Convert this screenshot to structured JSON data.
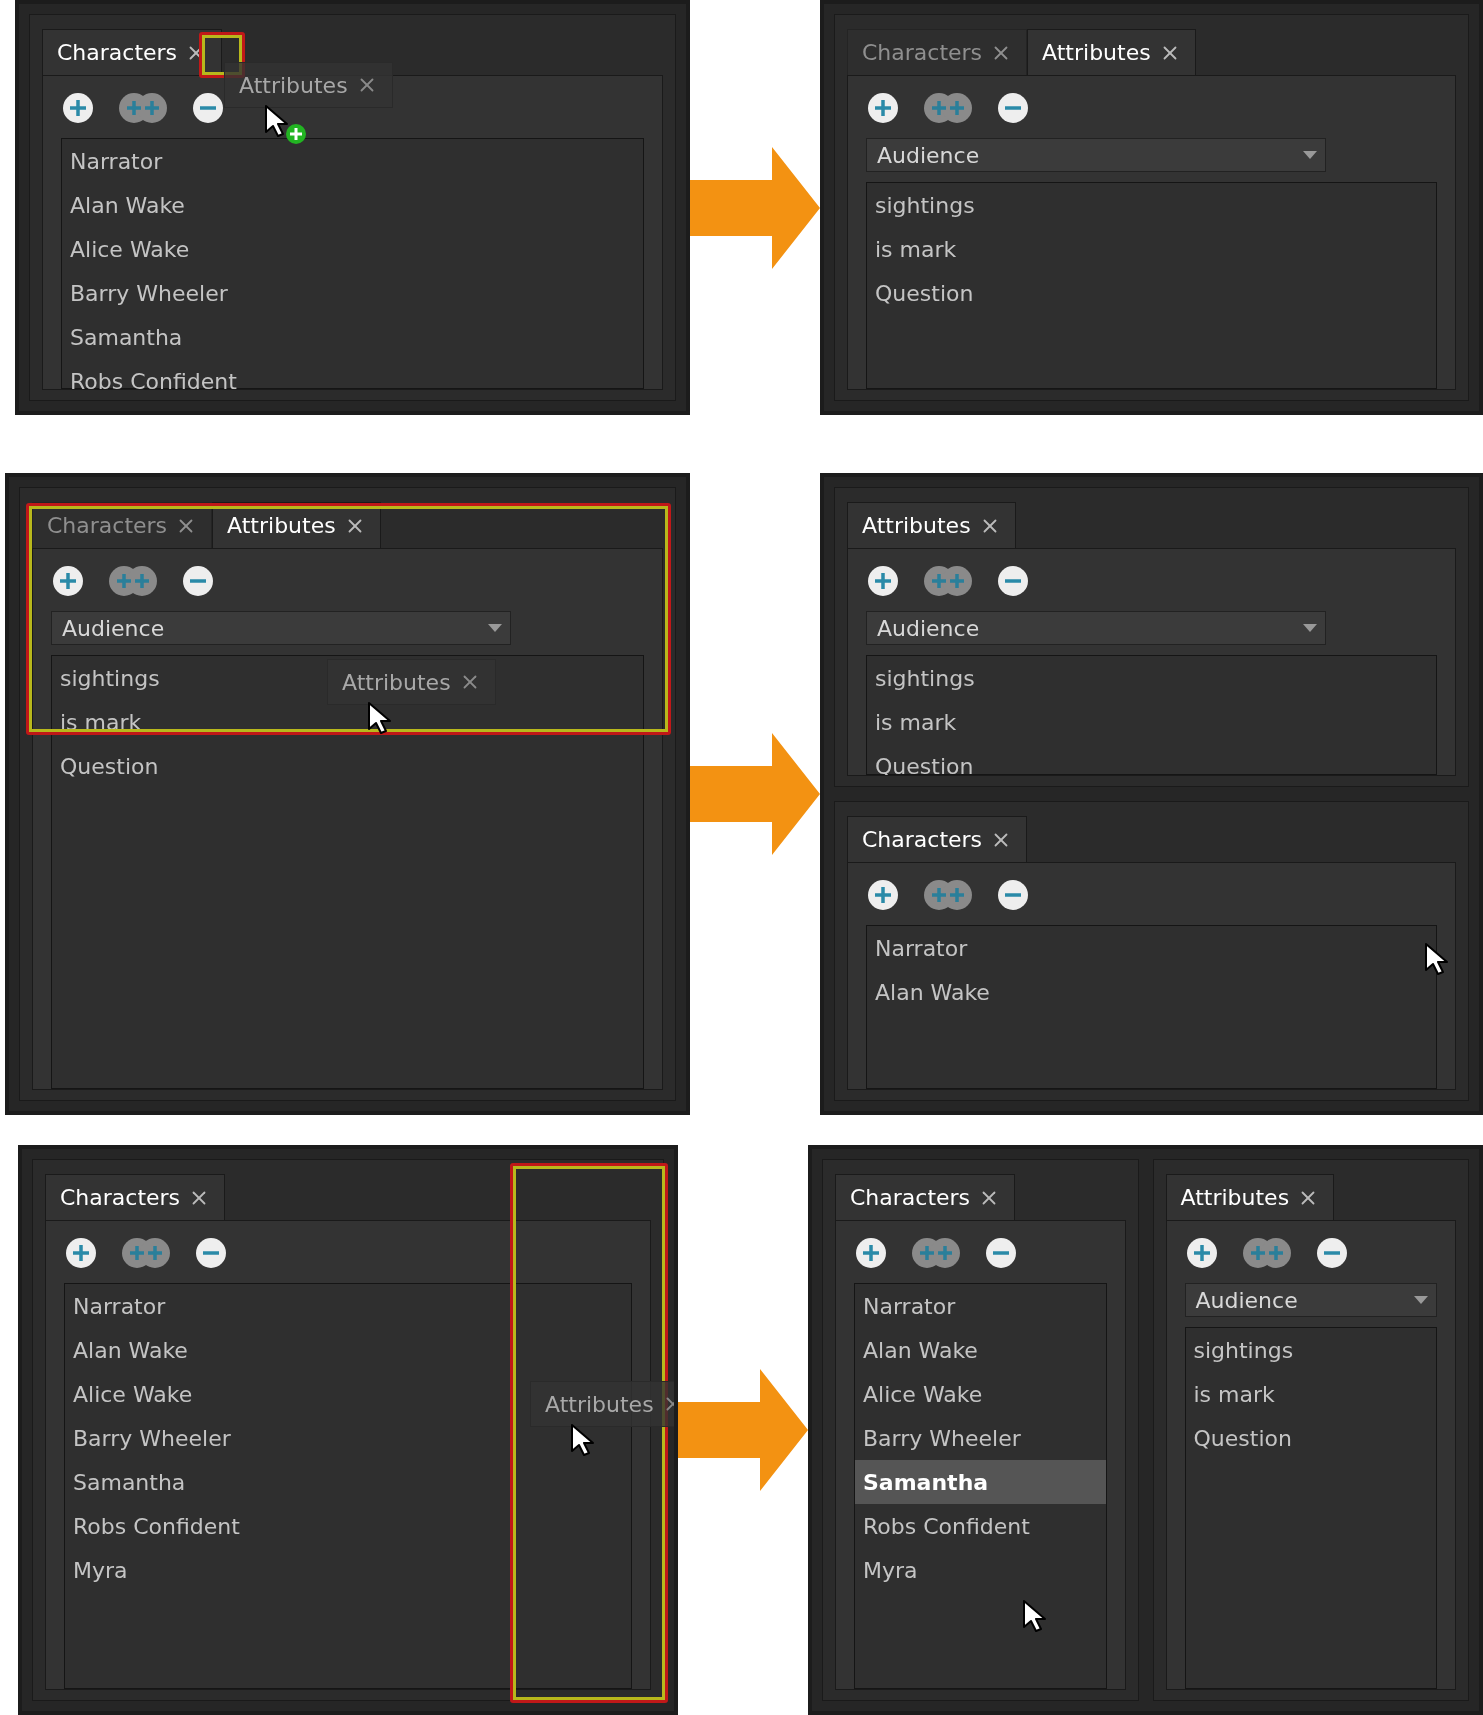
{
  "steps": [
    {
      "before": {
        "panes": [
          {
            "tabs": [
              {
                "label": "Characters",
                "selected": true
              }
            ],
            "items": [
              {
                "label": "Narrator",
                "selected": false
              },
              {
                "label": "Alan Wake",
                "selected": false
              },
              {
                "label": "Alice Wake",
                "selected": false
              },
              {
                "label": "Barry Wheeler",
                "selected": false
              },
              {
                "label": "Samantha",
                "selected": false
              },
              {
                "label": "Robs Confident",
                "selected": false
              }
            ]
          }
        ],
        "highlight": {
          "kind": "tab"
        },
        "ghost": {
          "label": "Attributes",
          "kind": "tab",
          "copy": true
        }
      },
      "after": {
        "panes": [
          {
            "tabs": [
              {
                "label": "Characters",
                "selected": false
              },
              {
                "label": "Attributes",
                "selected": true
              }
            ],
            "dropdown": "Audience",
            "items": [
              {
                "label": "sightings",
                "selected": false
              },
              {
                "label": "is mark",
                "selected": false
              },
              {
                "label": "Question",
                "selected": false
              }
            ]
          }
        ]
      }
    },
    {
      "before": {
        "panes": [
          {
            "tabs": [
              {
                "label": "Characters",
                "selected": false
              },
              {
                "label": "Attributes",
                "selected": true
              }
            ],
            "dropdown": "Audience",
            "items": [
              {
                "label": "sightings",
                "selected": false
              },
              {
                "label": "is mark",
                "selected": false
              },
              {
                "label": "Question",
                "selected": false
              }
            ]
          }
        ],
        "highlight": {
          "kind": "top"
        },
        "ghost": {
          "label": "Attributes",
          "kind": "list",
          "copy": false
        }
      },
      "after": {
        "side_by_side": false,
        "cursor": {
          "kind": "corner"
        },
        "panes": [
          {
            "tabs": [
              {
                "label": "Attributes",
                "selected": true
              }
            ],
            "dropdown": "Audience",
            "items": [
              {
                "label": "sightings",
                "selected": false
              },
              {
                "label": "is mark",
                "selected": false
              },
              {
                "label": "Question",
                "selected": false
              }
            ]
          },
          {
            "tabs": [
              {
                "label": "Characters",
                "selected": true
              }
            ],
            "items": [
              {
                "label": "Narrator",
                "selected": false
              },
              {
                "label": "Alan Wake",
                "selected": false
              }
            ]
          }
        ]
      }
    },
    {
      "before": {
        "panes": [
          {
            "tabs": [
              {
                "label": "Characters",
                "selected": true
              }
            ],
            "items": [
              {
                "label": "Narrator",
                "selected": false
              },
              {
                "label": "Alan Wake",
                "selected": false
              },
              {
                "label": "Alice Wake",
                "selected": false
              },
              {
                "label": "Barry Wheeler",
                "selected": false
              },
              {
                "label": "Samantha",
                "selected": false
              },
              {
                "label": "Robs Confident",
                "selected": false
              },
              {
                "label": "Myra",
                "selected": false
              }
            ]
          }
        ],
        "highlight": {
          "kind": "right"
        },
        "ghost": {
          "label": "Attributes",
          "kind": "side",
          "copy": false
        }
      },
      "after": {
        "side_by_side": true,
        "cursor": {
          "kind": "list"
        },
        "panes": [
          {
            "tabs": [
              {
                "label": "Characters",
                "selected": true
              }
            ],
            "items": [
              {
                "label": "Narrator",
                "selected": false
              },
              {
                "label": "Alan Wake",
                "selected": false
              },
              {
                "label": "Alice Wake",
                "selected": false
              },
              {
                "label": "Barry Wheeler",
                "selected": false
              },
              {
                "label": "Samantha",
                "selected": true
              },
              {
                "label": "Robs Confident",
                "selected": false
              },
              {
                "label": "Myra",
                "selected": false
              }
            ]
          },
          {
            "tabs": [
              {
                "label": "Attributes",
                "selected": true
              }
            ],
            "dropdown": "Audience",
            "items": [
              {
                "label": "sightings",
                "selected": false
              },
              {
                "label": "is mark",
                "selected": false
              },
              {
                "label": "Question",
                "selected": false
              }
            ]
          }
        ]
      }
    }
  ]
}
